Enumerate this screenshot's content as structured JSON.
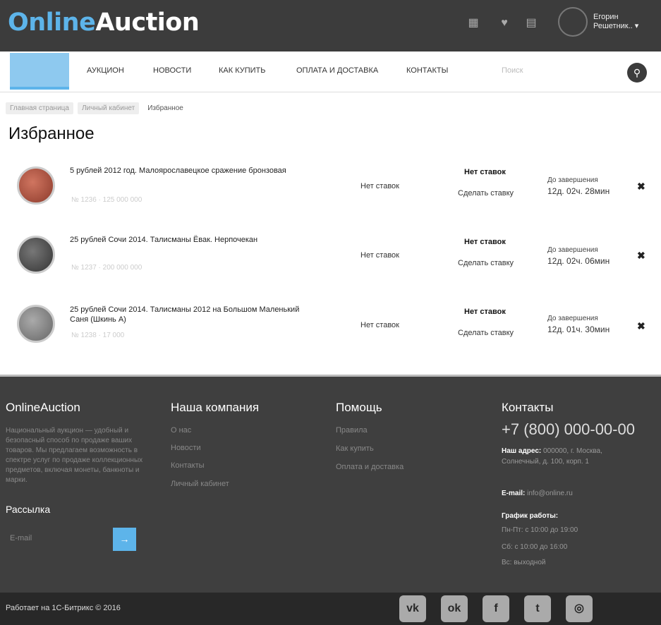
{
  "header": {
    "logo_part1": "Online",
    "logo_part2": "Auction",
    "icons": [
      "compare-icon",
      "favorites-icon",
      "cart-icon"
    ],
    "user_name_line1": "Егорин",
    "user_name_line2": "Решетник.."
  },
  "nav": {
    "items": [
      "Аукцион",
      "Новости",
      "Как купить",
      "Оплата и доставка",
      "Контакты"
    ],
    "search_placeholder": "Поиск"
  },
  "breadcrumbs": [
    "Главная страница",
    "Личный кабинет",
    "Избранное"
  ],
  "page_title": "Избранное",
  "lots": [
    {
      "name": "5 рублей 2012 год. Малоярославецкое сражение бронзовая",
      "sub": "№ 1236 · 125 000 000",
      "bids": "Нет ставок",
      "status": "Нет ставок",
      "action": "Сделать ставку",
      "time_label": "До завершения",
      "time_value": "12д. 02ч. 28мин",
      "coin_color": "#b5523d"
    },
    {
      "name": "25 рублей Сочи 2014. Талисманы Ёвак. Нерпочекан",
      "sub": "№ 1237 · 200 000 000",
      "bids": "Нет ставок",
      "status": "Нет ставок",
      "action": "Сделать ставку",
      "time_label": "До завершения",
      "time_value": "12д. 02ч. 06мин",
      "coin_color": "#4e4e4e"
    },
    {
      "name": "25 рублей Сочи 2014. Талисманы 2012 на Большом Маленький Саня (Шкинь А)",
      "sub": "№ 1238 · 17 000",
      "bids": "Нет ставок",
      "status": "Нет ставок",
      "action": "Сделать ставку",
      "time_label": "До завершения",
      "time_value": "12д. 01ч. 30мин",
      "coin_color": "#8a8a8a"
    }
  ],
  "footer": {
    "brand": "OnlineAuction",
    "about": "Национальный аукцион — удобный и безопасный способ по продаже ваших товаров. Мы предлагаем возможность в спектре услуг по продаже коллекционных предметов, включая монеты, банкноты и марки.",
    "newsletter_title": "Рассылка",
    "newsletter_placeholder": "E-mail",
    "company_title": "Наша компания",
    "company_links": [
      "О нас",
      "Новости",
      "Контакты",
      "Личный кабинет"
    ],
    "help_title": "Помощь",
    "help_links": [
      "Правила",
      "Как купить",
      "Оплата и доставка"
    ],
    "contacts_title": "Контакты",
    "phone": "+7 (800) 000-00-00",
    "address_label": "Наш адрес:",
    "address": "000000, г. Москва, Солнечный, д. 100, корп. 1",
    "email_label": "E-mail:",
    "email": "info@online.ru",
    "schedule_label": "График работы:",
    "schedule": [
      "Пн-Пт: с 10:00 до 19:00",
      "Сб: с 10:00 до 16:00",
      "Вс: выходной"
    ]
  },
  "bottom": {
    "copyright": "Работает на 1С-Битрикс © 2016",
    "social": [
      "vk-icon",
      "odnoklassniki-icon",
      "facebook-icon",
      "twitter-icon",
      "instagram-icon"
    ]
  }
}
